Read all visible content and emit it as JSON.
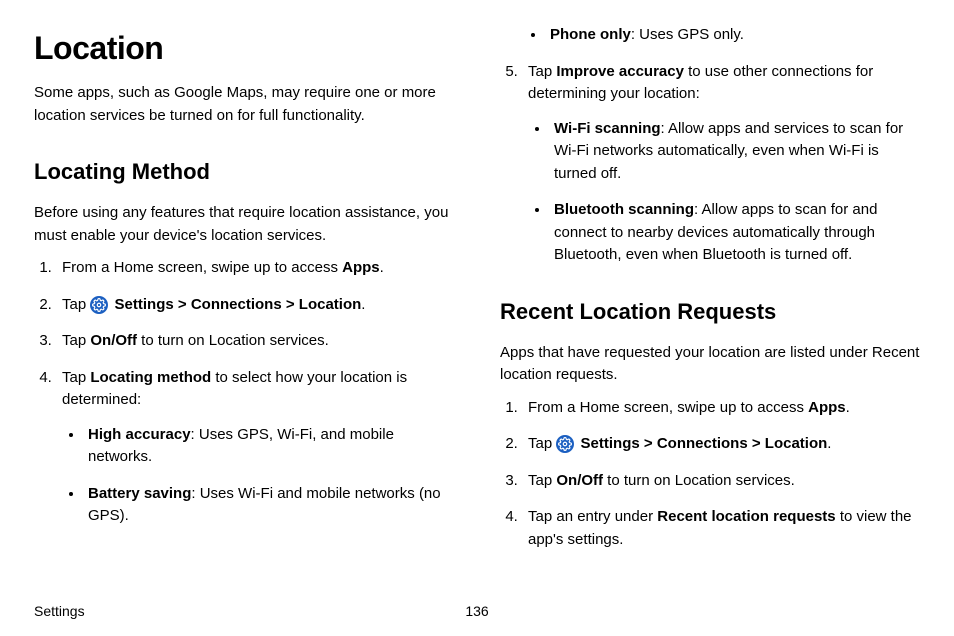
{
  "title": "Location",
  "intro": "Some apps, such as Google Maps, may require one or more location services be turned on for full functionality.",
  "section1": {
    "heading": "Locating Method",
    "intro": "Before using any features that require location assistance, you must enable your device's location services.",
    "ol": {
      "i1": {
        "prefix": "From a Home screen, swipe up to access ",
        "b": "Apps",
        "suffix": "."
      },
      "i2": {
        "tap": "Tap ",
        "settings": "Settings",
        "gt1": " > ",
        "connections": "Connections",
        "gt2": " > ",
        "location": "Location",
        "suffix": "."
      },
      "i3": {
        "tap": "Tap ",
        "b": "On/Off",
        "suffix": " to turn on Location services."
      },
      "i4": {
        "tap": "Tap ",
        "b": "Locating method",
        "suffix": " to select how your location is determined:",
        "bullets": {
          "b1": {
            "label": "High accuracy",
            "desc": ": Uses GPS, Wi-Fi, and mobile networks."
          },
          "b2": {
            "label": "Battery saving",
            "desc": ": Uses Wi-Fi and mobile networks (no GPS)."
          },
          "b3": {
            "label": "Phone only",
            "desc": ": Uses GPS only."
          }
        }
      },
      "i5": {
        "tap": "Tap ",
        "b": "Improve accuracy",
        "suffix": " to use other connections for determining your location:",
        "bullets": {
          "b1": {
            "label": "Wi-Fi scanning",
            "desc": ": Allow apps and services to scan for Wi-Fi networks automatically, even when Wi-Fi is turned off."
          },
          "b2": {
            "label": "Bluetooth scanning",
            "desc": ": Allow apps to scan for and connect to nearby devices automatically through Bluetooth, even when Bluetooth is turned off."
          }
        }
      }
    }
  },
  "section2": {
    "heading": "Recent Location Requests",
    "intro": "Apps that have requested your location are listed under Recent location requests.",
    "ol": {
      "i1": {
        "prefix": "From a Home screen, swipe up to access ",
        "b": "Apps",
        "suffix": "."
      },
      "i2": {
        "tap": "Tap ",
        "settings": "Settings",
        "gt1": " > ",
        "connections": "Connections",
        "gt2": " > ",
        "location": "Location",
        "suffix": "."
      },
      "i3": {
        "tap": "Tap ",
        "b": "On/Off",
        "suffix": " to turn on Location services."
      },
      "i4": {
        "prefix": "Tap an entry under ",
        "b": "Recent location requests",
        "suffix": " to view the app's settings."
      }
    }
  },
  "footer": {
    "section": "Settings",
    "page": "136"
  },
  "icon": {
    "name": "settings-gear"
  }
}
